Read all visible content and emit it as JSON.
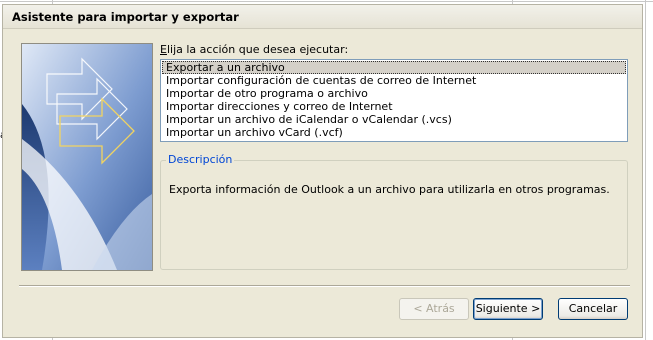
{
  "window": {
    "title": "Asistente para importar y exportar"
  },
  "prompt": {
    "accel": "E",
    "rest": "lija la acción que desea ejecutar:"
  },
  "actions": [
    "Exportar a un archivo",
    "Importar configuración de cuentas de correo de Internet",
    "Importar de otro programa o archivo",
    "Importar direcciones y correo de Internet",
    "Importar un archivo de iCalendar o vCalendar (.vcs)",
    "Importar un archivo vCard (.vcf)"
  ],
  "selected_index": 0,
  "description": {
    "legend": "Descripción",
    "text": "Exporta información de Outlook a un archivo para utilizarla en otros programas."
  },
  "buttons": {
    "back": "< Atrás",
    "next": "Siguiente >",
    "cancel": "Cancelar"
  },
  "background": {
    "stray_letter": "a"
  },
  "colors": {
    "dialog_face": "#ece9d8",
    "legend_blue": "#0046d5",
    "list_border": "#7f9db9",
    "button_border": "#003c74"
  }
}
